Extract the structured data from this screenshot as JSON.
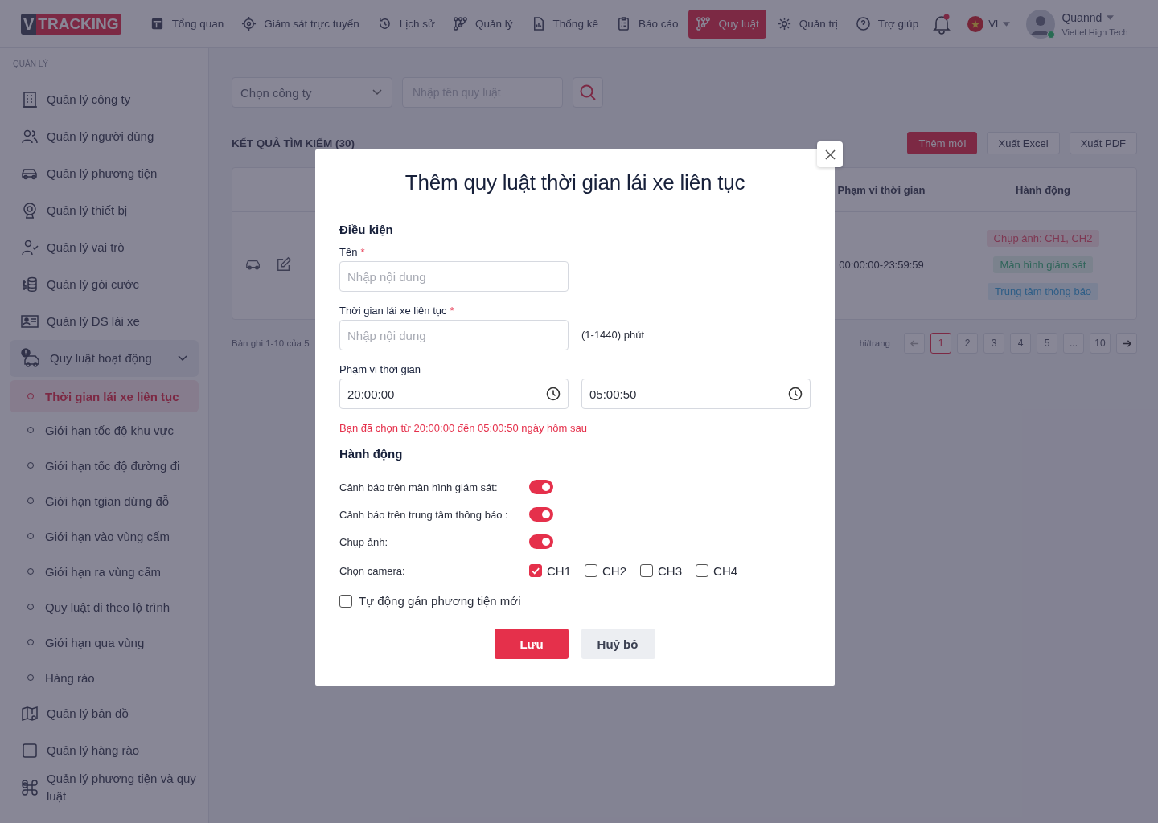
{
  "header": {
    "logo": {
      "mark": "V",
      "word": "TRACKING"
    },
    "nav": [
      {
        "label": "Tổng quan",
        "selected": false
      },
      {
        "label": "Giám sát trực tuyến",
        "selected": false
      },
      {
        "label": "Lịch sử",
        "selected": false
      },
      {
        "label": "Quản lý",
        "selected": false
      },
      {
        "label": "Thống kê",
        "selected": false
      },
      {
        "label": "Báo cáo",
        "selected": false
      },
      {
        "label": "Quy luật",
        "selected": true
      },
      {
        "label": "Quản trị",
        "selected": false
      },
      {
        "label": "Trợ giúp",
        "selected": false
      }
    ],
    "notifications": {
      "unread": true
    },
    "language": "VI",
    "user": {
      "name": "Quannd",
      "org": "Viettel High Tech",
      "online": true
    }
  },
  "sidebar": {
    "section": "QUẢN LÝ",
    "items": [
      {
        "kind": "item",
        "label": "Quản lý công ty"
      },
      {
        "kind": "item",
        "label": "Quản lý người dùng"
      },
      {
        "kind": "item",
        "label": "Quản lý phương tiện"
      },
      {
        "kind": "item",
        "label": "Quản lý thiết bị"
      },
      {
        "kind": "item",
        "label": "Quản lý vai trò"
      },
      {
        "kind": "item",
        "label": "Quản lý gói cước"
      },
      {
        "kind": "item",
        "label": "Quản lý DS lái xe"
      },
      {
        "kind": "group",
        "label": "Quy luật hoạt động",
        "expanded": true,
        "children": [
          {
            "label": "Thời gian lái xe liên tục",
            "selected": true
          },
          {
            "label": "Giới hạn tốc độ khu vực",
            "selected": false
          },
          {
            "label": "Giới hạn tốc độ đường đi",
            "selected": false
          },
          {
            "label": "Giới hạn tgian dừng đỗ",
            "selected": false
          },
          {
            "label": "Giới hạn vào vùng cấm",
            "selected": false
          },
          {
            "label": "Giới hạn ra vùng cấm",
            "selected": false
          },
          {
            "label": "Quy luật đi theo lộ trình",
            "selected": false
          },
          {
            "label": "Giới hạn qua vùng",
            "selected": false
          },
          {
            "label": "Hàng rào",
            "selected": false
          }
        ]
      },
      {
        "kind": "item",
        "label": "Quản lý bản đồ"
      },
      {
        "kind": "item",
        "label": "Quản lý hàng rào"
      },
      {
        "kind": "item",
        "label": "Quản lý phương tiện và quy luật"
      }
    ]
  },
  "filters": {
    "company": {
      "placeholder": "Chọn công ty"
    },
    "rule_name": {
      "placeholder": "Nhập tên quy luật"
    }
  },
  "results": {
    "title": "KẾT QUẢ TÌM KIẾM (30)",
    "buttons": [
      {
        "label": "Thêm mới",
        "kind": "primary"
      },
      {
        "label": "Xuất Excel",
        "kind": "outline"
      },
      {
        "label": "Xuất PDF",
        "kind": "outline"
      }
    ]
  },
  "table": {
    "columns": [
      "Phạm vi thời gian",
      "Hành động"
    ],
    "rows": [
      {
        "time_range": "00:00:00-23:59:59",
        "actions": [
          {
            "label": "Chụp ảnh: CH1, CH2",
            "kind": "photo"
          },
          {
            "label": "Màn hình giám sát",
            "kind": "monitor"
          },
          {
            "label": "Trung tâm thông báo",
            "kind": "notice"
          }
        ]
      }
    ]
  },
  "pagination": {
    "summary": "Bản ghi 1-10 của 5",
    "per_page": "hi/trang",
    "pages": [
      {
        "label": "1",
        "selected": true
      },
      {
        "label": "2",
        "selected": false
      },
      {
        "label": "3",
        "selected": false
      },
      {
        "label": "4",
        "selected": false
      },
      {
        "label": "5",
        "selected": false
      },
      {
        "label": "...",
        "selected": false
      },
      {
        "label": "10",
        "selected": false
      }
    ]
  },
  "modal": {
    "title": "Thêm quy luật thời gian lái xe liên tục",
    "condition_heading": "Điều kiện",
    "name": {
      "label": "Tên",
      "required_mark": "*",
      "placeholder": "Nhập nội dung"
    },
    "duration": {
      "label": "Thời gian lái xe liên tục",
      "required_mark": "*",
      "placeholder": "Nhập nội dung",
      "suffix": "(1-1440) phút"
    },
    "range": {
      "label": "Phạm vi thời gian",
      "start": "20:00:00",
      "end": "05:00:50",
      "note": "Bạn đã chọn từ 20:00:00 đến 05:00:50 ngày hôm sau"
    },
    "action_heading": "Hành động",
    "toggles": [
      {
        "label": "Cảnh báo trên màn hình giám sát:",
        "on": true
      },
      {
        "label": "Cảnh báo trên trung tâm thông báo :",
        "on": true
      },
      {
        "label": "Chụp ảnh:",
        "on": true
      }
    ],
    "camera": {
      "label": "Chọn camera:",
      "options": [
        {
          "label": "CH1",
          "checked": true
        },
        {
          "label": "CH2",
          "checked": false
        },
        {
          "label": "CH3",
          "checked": false
        },
        {
          "label": "CH4",
          "checked": false
        }
      ]
    },
    "auto_assign": {
      "label": "Tự động gán phương tiện mới",
      "checked": false
    },
    "buttons": [
      {
        "label": "Lưu",
        "kind": "primary"
      },
      {
        "label": "Huỷ bỏ",
        "kind": "secondary"
      }
    ]
  }
}
